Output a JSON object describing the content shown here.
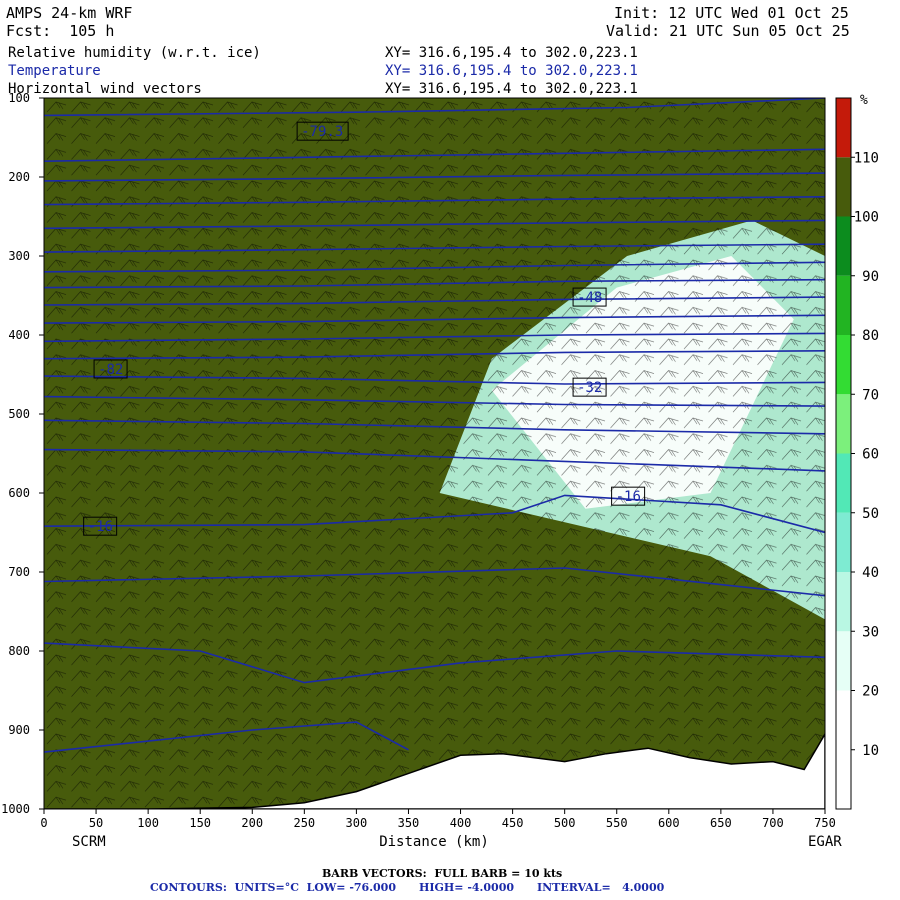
{
  "header": {
    "model": "AMPS 24-km WRF",
    "forecast": "Fcst:  105 h",
    "init": "Init: 12 UTC Wed 01 Oct 25",
    "valid": "Valid: 21 UTC Sun 05 Oct 25",
    "field1": "Relative humidity (w.r.t. ice)",
    "field2": "Temperature",
    "field3": "Horizontal wind vectors",
    "xy1": "XY= 316.6,195.4 to 302.0,223.1",
    "xy2": "XY= 316.6,195.4 to 302.0,223.1",
    "xy3": "XY= 316.6,195.4 to 302.0,223.1"
  },
  "footer": {
    "barb": "BARB VECTORS:  FULL BARB = 10 kts",
    "contours": "CONTOURS:  UNITS=°C  LOW= -76.000      HIGH= -4.0000      INTERVAL=   4.0000"
  },
  "colors": {
    "rh_levels": [
      "#ffffff",
      "#ffffff",
      "#e6fff6",
      "#b9f7e3",
      "#7eebd2",
      "#52e8b6",
      "#7cf07c",
      "#33dc33",
      "#22b422",
      "#0c8c1e",
      "#475b0c",
      "#c41a0a"
    ],
    "contour": "#1b2aa8",
    "terrain": "#ffffff"
  },
  "chart_data": {
    "type": "heatmap",
    "title": "Relative humidity (w.r.t. ice) / Temperature / Horizontal wind vectors",
    "xlabel": "Distance (km)",
    "ylabel": "Pressure (hPa)",
    "xlim": [
      0,
      750
    ],
    "ylim": [
      1000,
      100
    ],
    "x_ticks": [
      0,
      50,
      100,
      150,
      200,
      250,
      300,
      350,
      400,
      450,
      500,
      550,
      600,
      650,
      700,
      750
    ],
    "y_ticks": [
      100,
      200,
      300,
      400,
      500,
      600,
      700,
      800,
      900,
      1000
    ],
    "x_endpoints": [
      "SCRM",
      "EGAR"
    ],
    "colorbar": {
      "unit": "%",
      "ticks": [
        10,
        20,
        30,
        40,
        50,
        60,
        70,
        80,
        90,
        100,
        110
      ],
      "bounds": [
        0,
        10,
        20,
        30,
        40,
        50,
        60,
        70,
        80,
        90,
        100,
        110,
        120
      ]
    },
    "contour_labels": [
      {
        "text": "-79.3",
        "x": 245,
        "p": 142
      },
      {
        "text": "-48",
        "x": 510,
        "p": 352
      },
      {
        "text": "-32",
        "x": 510,
        "p": 466
      },
      {
        "text": "-16",
        "x": 547,
        "p": 604
      },
      {
        "text": "-82",
        "x": 50,
        "p": 443
      },
      {
        "text": "-16",
        "x": 40,
        "p": 642
      }
    ],
    "terrain_surface": [
      {
        "x": 0,
        "p": 1000
      },
      {
        "x": 100,
        "p": 1000
      },
      {
        "x": 200,
        "p": 998
      },
      {
        "x": 250,
        "p": 992
      },
      {
        "x": 300,
        "p": 978
      },
      {
        "x": 350,
        "p": 955
      },
      {
        "x": 400,
        "p": 932
      },
      {
        "x": 440,
        "p": 930
      },
      {
        "x": 470,
        "p": 935
      },
      {
        "x": 500,
        "p": 940
      },
      {
        "x": 540,
        "p": 930
      },
      {
        "x": 580,
        "p": 923
      },
      {
        "x": 620,
        "p": 935
      },
      {
        "x": 660,
        "p": 943
      },
      {
        "x": 700,
        "p": 940
      },
      {
        "x": 730,
        "p": 950
      },
      {
        "x": 750,
        "p": 905
      }
    ],
    "isotherms_C": [
      {
        "value": -79,
        "points": [
          {
            "x": 0,
            "p": 122
          },
          {
            "x": 300,
            "p": 118
          },
          {
            "x": 560,
            "p": 112
          },
          {
            "x": 750,
            "p": 100
          }
        ]
      },
      {
        "value": -76,
        "points": [
          {
            "x": 0,
            "p": 180
          },
          {
            "x": 250,
            "p": 175
          },
          {
            "x": 500,
            "p": 170
          },
          {
            "x": 750,
            "p": 165
          }
        ]
      },
      {
        "value": -72,
        "points": [
          {
            "x": 0,
            "p": 205
          },
          {
            "x": 250,
            "p": 202
          },
          {
            "x": 500,
            "p": 198
          },
          {
            "x": 750,
            "p": 195
          }
        ]
      },
      {
        "value": -68,
        "points": [
          {
            "x": 0,
            "p": 235
          },
          {
            "x": 250,
            "p": 232
          },
          {
            "x": 500,
            "p": 228
          },
          {
            "x": 750,
            "p": 225
          }
        ]
      },
      {
        "value": -64,
        "points": [
          {
            "x": 0,
            "p": 265
          },
          {
            "x": 250,
            "p": 262
          },
          {
            "x": 500,
            "p": 258
          },
          {
            "x": 750,
            "p": 255
          }
        ]
      },
      {
        "value": -60,
        "points": [
          {
            "x": 0,
            "p": 295
          },
          {
            "x": 250,
            "p": 292
          },
          {
            "x": 500,
            "p": 288
          },
          {
            "x": 750,
            "p": 285
          }
        ]
      },
      {
        "value": -56,
        "points": [
          {
            "x": 0,
            "p": 320
          },
          {
            "x": 250,
            "p": 318
          },
          {
            "x": 500,
            "p": 312
          },
          {
            "x": 750,
            "p": 308
          }
        ]
      },
      {
        "value": -52,
        "points": [
          {
            "x": 0,
            "p": 340
          },
          {
            "x": 250,
            "p": 338
          },
          {
            "x": 500,
            "p": 332
          },
          {
            "x": 750,
            "p": 330
          }
        ]
      },
      {
        "value": -48,
        "points": [
          {
            "x": 0,
            "p": 362
          },
          {
            "x": 250,
            "p": 360
          },
          {
            "x": 500,
            "p": 355
          },
          {
            "x": 750,
            "p": 352
          }
        ]
      },
      {
        "value": -44,
        "points": [
          {
            "x": 0,
            "p": 385
          },
          {
            "x": 250,
            "p": 383
          },
          {
            "x": 500,
            "p": 378
          },
          {
            "x": 750,
            "p": 375
          }
        ]
      },
      {
        "value": -40,
        "points": [
          {
            "x": 0,
            "p": 408
          },
          {
            "x": 250,
            "p": 405
          },
          {
            "x": 500,
            "p": 400
          },
          {
            "x": 750,
            "p": 398
          }
        ]
      },
      {
        "value": -36,
        "points": [
          {
            "x": 0,
            "p": 430
          },
          {
            "x": 250,
            "p": 428
          },
          {
            "x": 500,
            "p": 422
          },
          {
            "x": 750,
            "p": 420
          }
        ]
      },
      {
        "value": -32,
        "points": [
          {
            "x": 0,
            "p": 452
          },
          {
            "x": 250,
            "p": 455
          },
          {
            "x": 500,
            "p": 462
          },
          {
            "x": 750,
            "p": 460
          }
        ]
      },
      {
        "value": -28,
        "points": [
          {
            "x": 0,
            "p": 478
          },
          {
            "x": 250,
            "p": 482
          },
          {
            "x": 500,
            "p": 488
          },
          {
            "x": 750,
            "p": 490
          }
        ]
      },
      {
        "value": -24,
        "points": [
          {
            "x": 0,
            "p": 508
          },
          {
            "x": 250,
            "p": 512
          },
          {
            "x": 500,
            "p": 520
          },
          {
            "x": 750,
            "p": 525
          }
        ]
      },
      {
        "value": -20,
        "points": [
          {
            "x": 0,
            "p": 545
          },
          {
            "x": 250,
            "p": 548
          },
          {
            "x": 500,
            "p": 560
          },
          {
            "x": 750,
            "p": 572
          }
        ]
      },
      {
        "value": -16,
        "points": [
          {
            "x": 0,
            "p": 642
          },
          {
            "x": 250,
            "p": 640
          },
          {
            "x": 450,
            "p": 625
          },
          {
            "x": 500,
            "p": 603
          },
          {
            "x": 650,
            "p": 615
          },
          {
            "x": 750,
            "p": 650
          }
        ]
      },
      {
        "value": -12,
        "points": [
          {
            "x": 0,
            "p": 712
          },
          {
            "x": 250,
            "p": 705
          },
          {
            "x": 500,
            "p": 695
          },
          {
            "x": 750,
            "p": 730
          }
        ]
      },
      {
        "value": -8,
        "points": [
          {
            "x": 0,
            "p": 790
          },
          {
            "x": 150,
            "p": 800
          },
          {
            "x": 250,
            "p": 840
          },
          {
            "x": 400,
            "p": 815
          },
          {
            "x": 550,
            "p": 800
          },
          {
            "x": 750,
            "p": 808
          }
        ]
      },
      {
        "value": -4,
        "points": [
          {
            "x": 0,
            "p": 928
          },
          {
            "x": 200,
            "p": 900
          },
          {
            "x": 300,
            "p": 890
          },
          {
            "x": 350,
            "p": 925
          }
        ]
      }
    ],
    "rh_regions": [
      {
        "class": 3,
        "points": [
          {
            "x": 380,
            "p": 600
          },
          {
            "x": 430,
            "p": 430
          },
          {
            "x": 560,
            "p": 300
          },
          {
            "x": 680,
            "p": 255
          },
          {
            "x": 750,
            "p": 300
          },
          {
            "x": 750,
            "p": 760
          },
          {
            "x": 640,
            "p": 680
          }
        ]
      },
      {
        "class": 1,
        "points": [
          {
            "x": 430,
            "p": 470
          },
          {
            "x": 550,
            "p": 340
          },
          {
            "x": 660,
            "p": 300
          },
          {
            "x": 720,
            "p": 380
          },
          {
            "x": 640,
            "p": 600
          },
          {
            "x": 520,
            "p": 620
          }
        ]
      }
    ]
  }
}
